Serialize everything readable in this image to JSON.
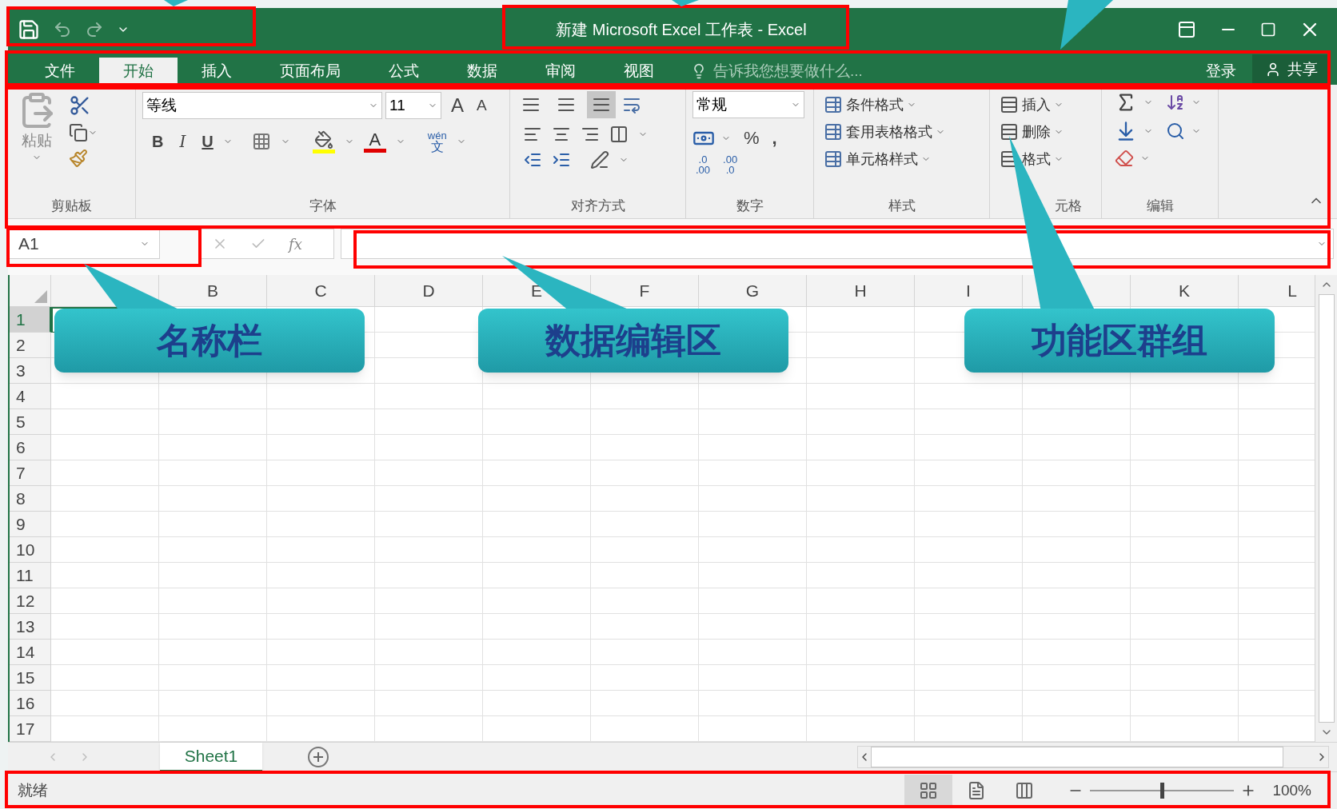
{
  "window": {
    "title": "新建 Microsoft Excel 工作表 - Excel"
  },
  "tabs": [
    {
      "label": "文件",
      "selected": false
    },
    {
      "label": "开始",
      "selected": true
    },
    {
      "label": "插入",
      "selected": false
    },
    {
      "label": "页面布局",
      "selected": false
    },
    {
      "label": "公式",
      "selected": false
    },
    {
      "label": "数据",
      "selected": false
    },
    {
      "label": "审阅",
      "selected": false
    },
    {
      "label": "视图",
      "selected": false
    }
  ],
  "tell_me": {
    "placeholder": "告诉我您想要做什么..."
  },
  "account": {
    "sign_in": "登录",
    "share": "共享"
  },
  "ribbon": {
    "clipboard": {
      "label": "剪贴板",
      "paste": "粘贴"
    },
    "font": {
      "label": "字体",
      "font_name": "等线",
      "font_size": "11",
      "grow": "A",
      "shrink": "A",
      "bold": "B",
      "italic": "I",
      "underline": "U",
      "font_color": "A",
      "phonetic_top": "wén",
      "phonetic_bottom": "文"
    },
    "alignment": {
      "label": "对齐方式",
      "vertical_align": [
        {
          "selected": false
        },
        {
          "selected": false
        },
        {
          "selected": true
        }
      ]
    },
    "number": {
      "label": "数字",
      "format": "常规",
      "percent": "%",
      "comma": ",",
      "increase_decimal": [
        ".0",
        ".00"
      ],
      "decrease_decimal": [
        ".00",
        ".0"
      ]
    },
    "styles": {
      "label": "样式",
      "items": [
        "条件格式",
        "套用表格格式",
        "单元格样式"
      ]
    },
    "cells": {
      "label": "元格",
      "items": [
        "插入",
        "删除",
        "格式"
      ]
    },
    "editing": {
      "label": "编辑"
    }
  },
  "formula_bar": {
    "name_box": "A1",
    "function_label": "fx"
  },
  "grid": {
    "columns": [
      {},
      {
        "label": "B"
      },
      {
        "label": "C"
      },
      {
        "label": "D"
      },
      {
        "label": "E"
      },
      {
        "label": "F"
      },
      {
        "label": "G"
      },
      {
        "label": "H"
      },
      {
        "label": "I"
      },
      {},
      {
        "label": "K"
      },
      {
        "label": "L"
      }
    ],
    "rows": [
      {
        "label": "1",
        "selected": true
      },
      {
        "label": "2",
        "selected": false
      },
      {
        "label": "3",
        "selected": false
      },
      {
        "label": "4",
        "selected": false
      },
      {
        "label": "5",
        "selected": false
      },
      {
        "label": "6",
        "selected": false
      },
      {
        "label": "7",
        "selected": false
      },
      {
        "label": "8",
        "selected": false
      },
      {
        "label": "9",
        "selected": false
      },
      {
        "label": "10",
        "selected": false
      },
      {
        "label": "11",
        "selected": false
      },
      {
        "label": "12",
        "selected": false
      },
      {
        "label": "13",
        "selected": false
      },
      {
        "label": "14",
        "selected": false
      },
      {
        "label": "15",
        "selected": false
      },
      {
        "label": "16",
        "selected": false
      },
      {
        "label": "17",
        "selected": false
      }
    ]
  },
  "sheets": [
    {
      "name": "Sheet1",
      "selected": true
    }
  ],
  "status_bar": {
    "text": "就绪",
    "zoom": "100%",
    "zoom_slider": {
      "level": 0.5
    },
    "views": [
      {
        "kind": "normal",
        "selected": true
      },
      {
        "kind": "page_layout",
        "selected": false
      },
      {
        "kind": "page_break",
        "selected": false
      }
    ]
  },
  "callouts": [
    {
      "text": "名称栏"
    },
    {
      "text": "数据编辑区"
    },
    {
      "text": "功能区群组"
    }
  ]
}
